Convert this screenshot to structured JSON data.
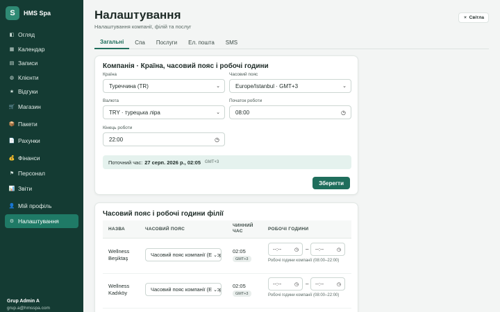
{
  "app": {
    "logo_letter": "S",
    "name": "HMS Spa"
  },
  "sidebar": {
    "items": [
      {
        "icon": "◧",
        "label": "Огляд"
      },
      {
        "icon": "▦",
        "label": "Календар"
      },
      {
        "icon": "▤",
        "label": "Записи"
      },
      {
        "icon": "◍",
        "label": "Клієнти"
      },
      {
        "icon": "★",
        "label": "Відгуки"
      },
      {
        "icon": "🛒",
        "label": "Магазин"
      },
      {
        "icon": "📦",
        "label": "Пакети"
      },
      {
        "icon": "📄",
        "label": "Рахунки"
      },
      {
        "icon": "💰",
        "label": "Фінанси"
      },
      {
        "icon": "⚑",
        "label": "Персонал"
      },
      {
        "icon": "📊",
        "label": "Звіти"
      },
      {
        "icon": "👤",
        "label": "Мій профіль"
      },
      {
        "icon": "⚙",
        "label": "Налаштування"
      }
    ],
    "user": {
      "name": "Grup Admin A",
      "email": "grup.a@hmsspa.com"
    }
  },
  "header": {
    "title": "Налаштування",
    "subtitle": "Налаштування компанії, філій та послуг",
    "theme_icon": "☀",
    "theme_label": "Світла"
  },
  "tabs": [
    {
      "label": "Загальні"
    },
    {
      "label": "Спа"
    },
    {
      "label": "Послуги"
    },
    {
      "label": "Ел. пошта"
    },
    {
      "label": "SMS"
    }
  ],
  "company": {
    "title": "Компанія · Країна, часовий пояс і робочі години",
    "country_label": "Країна",
    "country_value": "Туреччина (TR)",
    "timezone_label": "Часовий пояс",
    "timezone_value": "Europe/Istanbul · GMT+3",
    "currency_label": "Валюта",
    "currency_value": "TRY · турецька ліра",
    "start_label": "Початок роботи",
    "start_value": "08:00",
    "end_label": "Кінець роботи",
    "end_value": "22:00",
    "now_label": "Поточний час:",
    "now_value": "27 серп. 2026 р., 02:05",
    "now_tz": "GMT+3",
    "save_label": "Зберегти"
  },
  "branches": {
    "title": "Часовий пояс і робочі години філії",
    "headers": {
      "name": "НАЗВА",
      "tz": "ЧАСОВИЙ ПОЯС",
      "current": "ЧИННИЙ ЧАС",
      "hours": "РОБОЧІ ГОДИНИ"
    },
    "rows": [
      {
        "name": "Wellness Beşiktaş",
        "tz": "Часовий пояс компанії (Europe/Istanbul)",
        "time": "02:05",
        "gmt": "GMT+3",
        "from": "--:--",
        "to": "--:--",
        "hint": "Робочі години компанії (08:00–22:00)"
      },
      {
        "name": "Wellness Kadıköy",
        "tz": "Часовий пояс компанії (Europe/Istanbul)",
        "time": "02:05",
        "gmt": "GMT+3",
        "from": "--:--",
        "to": "--:--",
        "hint": "Робочі години компанії (08:00–22:00)"
      }
    ],
    "dash": "–"
  }
}
